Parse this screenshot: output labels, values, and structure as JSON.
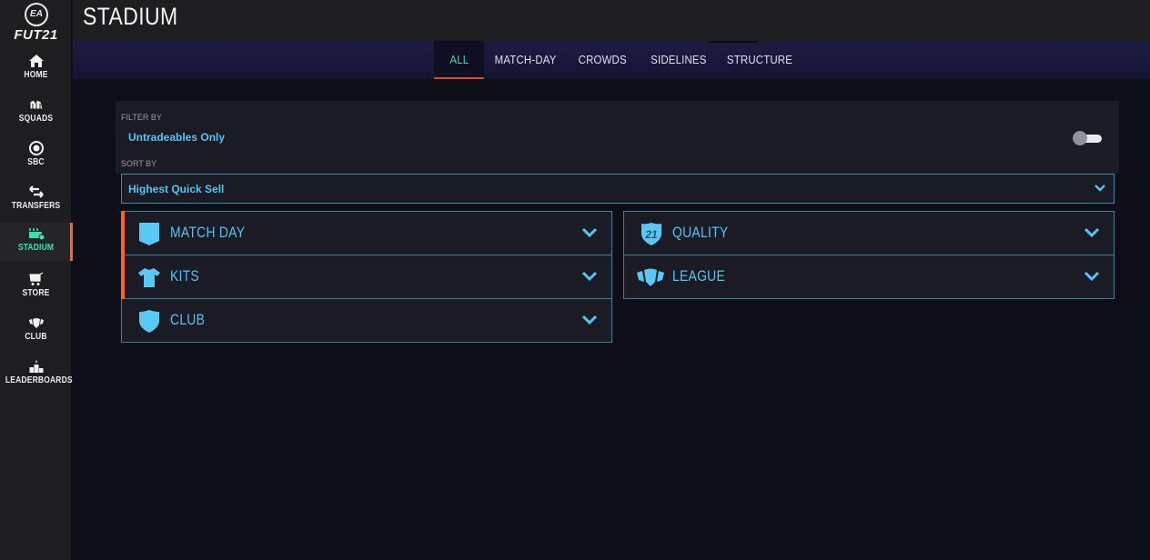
{
  "app": {
    "logo_badge": "EA",
    "logo_text": "FUT21",
    "accent_active": "#3fe0a8",
    "accent_indicator": "#ff5f2a",
    "accent_text": "#55c4f2"
  },
  "sidebar": {
    "items": [
      {
        "label": "HOME",
        "icon": "home-icon",
        "active": false
      },
      {
        "label": "SQUADS",
        "icon": "squads-icon",
        "active": false
      },
      {
        "label": "SBC",
        "icon": "sbc-icon",
        "active": false
      },
      {
        "label": "TRANSFERS",
        "icon": "transfers-icon",
        "active": false
      },
      {
        "label": "STADIUM",
        "icon": "stadium-icon",
        "active": true
      },
      {
        "label": "STORE",
        "icon": "cart-icon",
        "active": false
      },
      {
        "label": "CLUB",
        "icon": "club-icon",
        "active": false
      },
      {
        "label": "LEADERBOARDS",
        "icon": "podium-icon",
        "active": false
      }
    ]
  },
  "header": {
    "title": "STADIUM"
  },
  "tabs": [
    {
      "label": "ALL",
      "active": true
    },
    {
      "label": "MATCH-DAY",
      "active": false
    },
    {
      "label": "CROWDS",
      "active": false
    },
    {
      "label": "SIDELINES",
      "active": false
    },
    {
      "label": "STRUCTURE",
      "active": false
    }
  ],
  "filter": {
    "label": "FILTER BY",
    "option": "Untradeables Only",
    "toggle_on": false
  },
  "sort": {
    "label": "SORT BY",
    "selected": "Highest Quick Sell"
  },
  "categories": {
    "left": [
      {
        "title": "MATCH DAY",
        "icon": "badge-icon",
        "flagged": true
      },
      {
        "title": "KITS",
        "icon": "shirt-icon",
        "flagged": true
      },
      {
        "title": "CLUB",
        "icon": "crest-icon",
        "flagged": false
      }
    ],
    "right": [
      {
        "title": "QUALITY",
        "icon": "quality-21-icon",
        "badge_text": "21",
        "flagged": false
      },
      {
        "title": "LEAGUE",
        "icon": "league-icon",
        "flagged": false
      }
    ]
  }
}
